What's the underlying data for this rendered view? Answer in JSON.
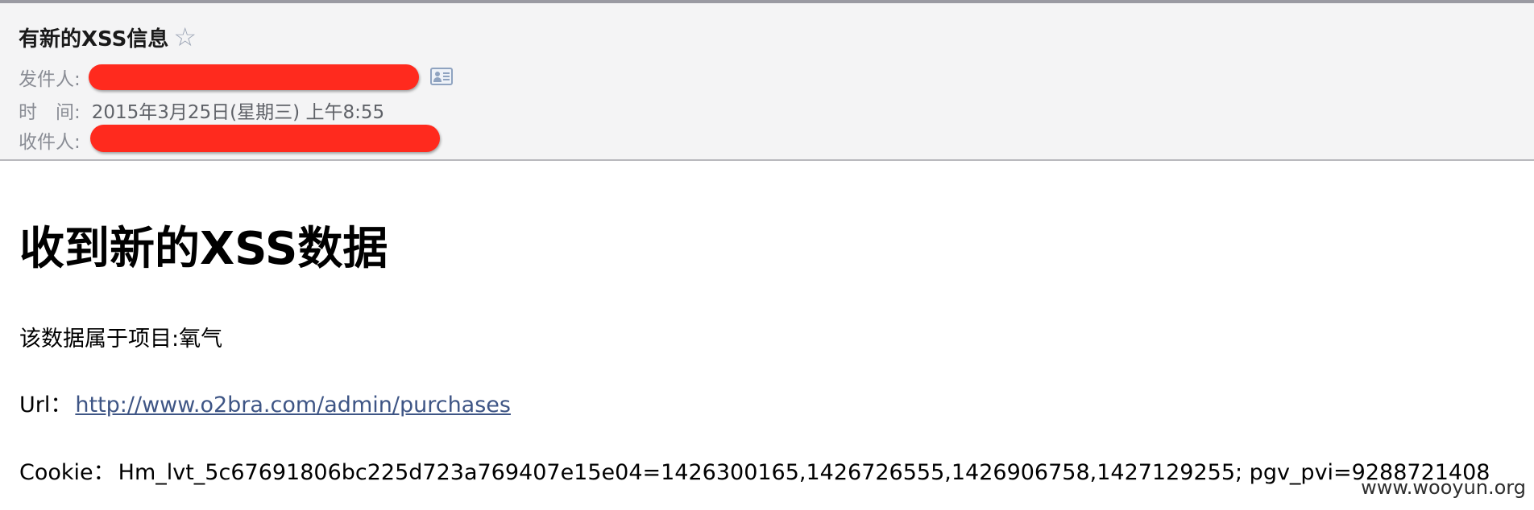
{
  "header": {
    "subject": "有新的XSS信息",
    "star_glyph": "☆",
    "from_label": "发件人:",
    "time_label": "时　间:",
    "time_value": "2015年3月25日(星期三) 上午8:55",
    "to_label": "收件人:",
    "redaction_color": "#ff2a1e"
  },
  "body": {
    "title": "收到新的XSS数据",
    "project_line": "该数据属于项目:氧气",
    "url_label": "Url：",
    "url_value": "http://www.o2bra.com/admin/purchases",
    "cookie_label": "Cookie：",
    "cookie_value": "Hm_lvt_5c67691806bc225d723a769407e15e04=1426300165,1426726555,1426906758,1427129255; pgv_pvi=9288721408"
  },
  "watermark": "www.wooyun.org",
  "colors": {
    "header_bg": "#f4f4f5",
    "label_gray": "#8a8d95",
    "link_blue": "#3e5585",
    "star_gray": "#9aa3b4"
  }
}
